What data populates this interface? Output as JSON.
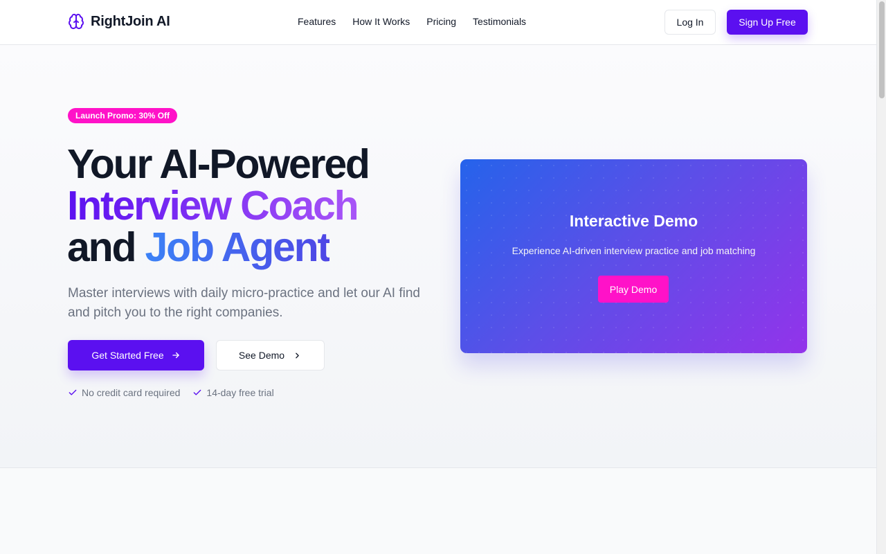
{
  "brand": {
    "name": "RightJoin AI",
    "icon": "brain-icon",
    "color": "#5b10f0"
  },
  "nav": {
    "items": [
      "Features",
      "How It Works",
      "Pricing",
      "Testimonials"
    ]
  },
  "header": {
    "login_label": "Log In",
    "signup_label": "Sign Up Free"
  },
  "hero": {
    "promo": "Launch Promo: 30% Off",
    "headline_line1": "Your AI-Powered",
    "headline_accent1": "Interview Coach",
    "headline_and": "and",
    "headline_accent2": "Job Agent",
    "subtitle": "Master interviews with daily micro-practice and let our AI find and pitch you to the right companies.",
    "cta_primary": "Get Started Free",
    "cta_secondary": "See Demo",
    "checks": [
      "No credit card required",
      "14-day free trial"
    ]
  },
  "demo": {
    "title": "Interactive Demo",
    "subtitle": "Experience AI-driven interview practice and job matching",
    "button": "Play Demo"
  },
  "colors": {
    "accent": "#5b10f0",
    "pink": "#ff12c8",
    "blue": "#2563eb",
    "purple": "#9333ea"
  }
}
